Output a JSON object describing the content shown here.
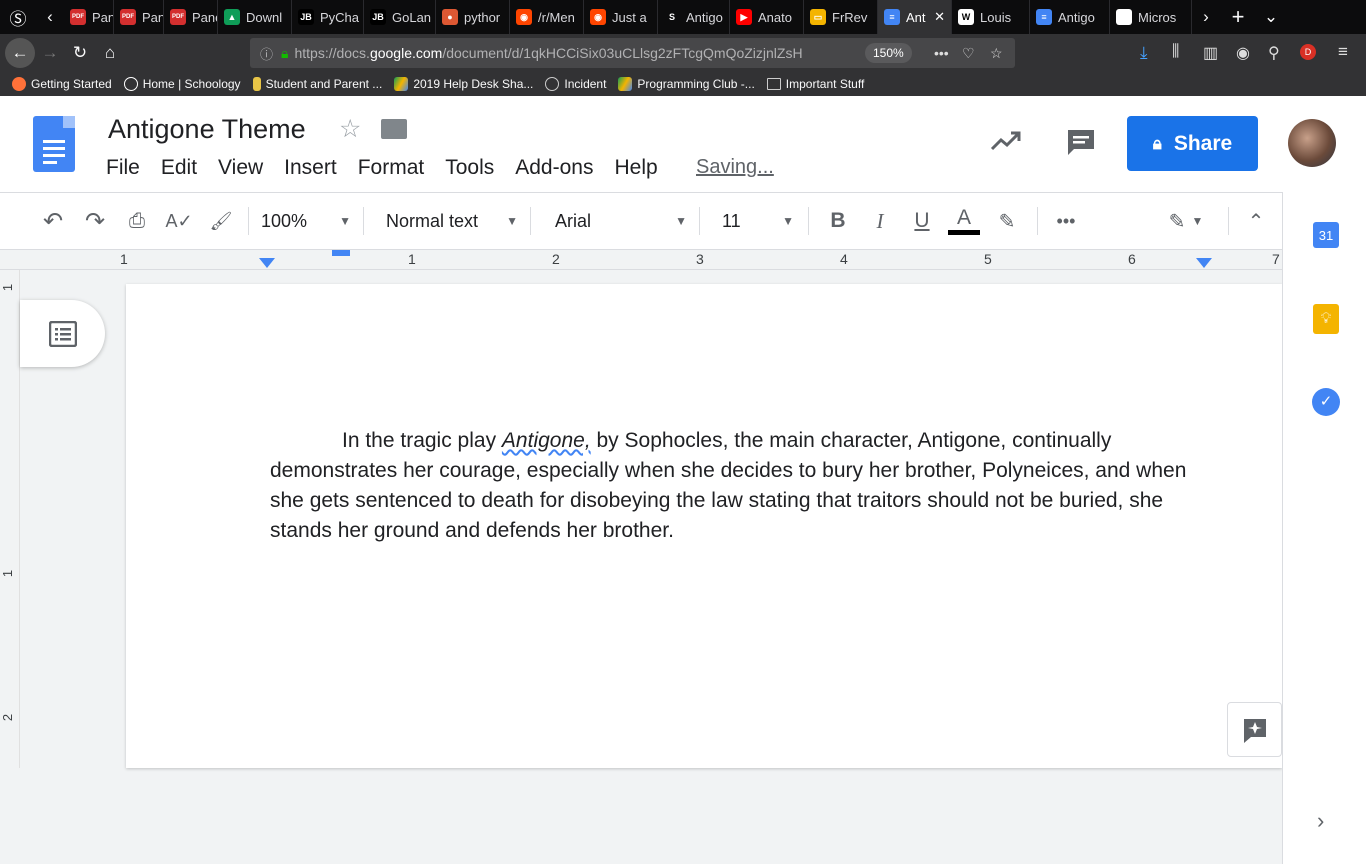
{
  "browser": {
    "tabs": [
      {
        "label": "Panel",
        "icon": "pdf-icon"
      },
      {
        "label": "Panel",
        "icon": "pdf-icon"
      },
      {
        "label": "Panel",
        "icon": "pdf-icon"
      },
      {
        "label": "Downl",
        "icon": "android-icon"
      },
      {
        "label": "PyCha",
        "icon": "jetbrains-icon"
      },
      {
        "label": "GoLan",
        "icon": "jetbrains-icon"
      },
      {
        "label": "pythor",
        "icon": "duckduckgo-icon"
      },
      {
        "label": "/r/Men",
        "icon": "reddit-icon"
      },
      {
        "label": "Just a",
        "icon": "reddit-icon"
      },
      {
        "label": "Antigo",
        "icon": "schoology-icon"
      },
      {
        "label": "Anato",
        "icon": "youtube-icon"
      },
      {
        "label": "FrRev",
        "icon": "slides-icon"
      },
      {
        "label": "Ant",
        "icon": "docs-icon"
      },
      {
        "label": "Louis",
        "icon": "wikipedia-icon"
      },
      {
        "label": "Antigo",
        "icon": "docs-icon"
      },
      {
        "label": "Micros",
        "icon": "blank-icon"
      }
    ],
    "url_prefix": "https://docs.",
    "url_domain": "google.com",
    "url_rest": "/document/d/1qkHCCiSix03uCLlsg2zFTcgQmQoZizjnlZsH",
    "zoom": "150%",
    "bookmarks": [
      {
        "label": "Getting Started"
      },
      {
        "label": "Home | Schoology"
      },
      {
        "label": "Student and Parent ..."
      },
      {
        "label": "2019 Help Desk Sha..."
      },
      {
        "label": "Incident"
      },
      {
        "label": "Programming Club -..."
      },
      {
        "label": "Important Stuff"
      }
    ]
  },
  "docs": {
    "title": "Antigone Theme",
    "menu": [
      "File",
      "Edit",
      "View",
      "Insert",
      "Format",
      "Tools",
      "Add-ons",
      "Help"
    ],
    "status": "Saving...",
    "share_label": "Share",
    "toolbar": {
      "zoom": "100%",
      "style": "Normal text",
      "font": "Arial",
      "size": "11"
    },
    "ruler_labels": [
      "1",
      "1",
      "2",
      "3",
      "4",
      "5",
      "6",
      "7"
    ],
    "vruler_labels": [
      "1",
      "1",
      "2"
    ],
    "paragraph": {
      "before": "In the tragic play ",
      "italic": "Antigone,",
      "after_line1": " by Sophocles, the main character, Antigone, continually demonstrates her courage, especially when she decides to bury her brother, Polyneices, and when she gets sentenced to death for disobeying the law stating that traitors should not be buried, she stands her ground and defends her brother."
    },
    "colors": {
      "accent": "#1a73e8",
      "docs_blue": "#4285f4"
    }
  }
}
